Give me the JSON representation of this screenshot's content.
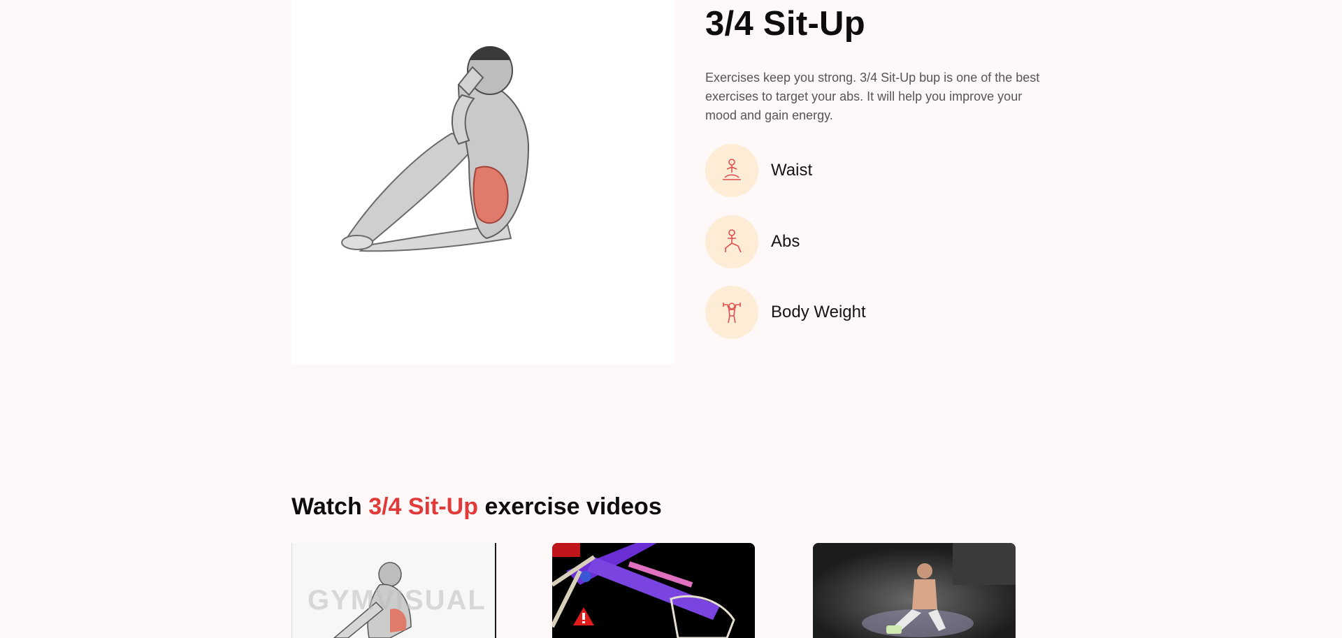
{
  "exercise": {
    "title": "3/4 Sit-Up",
    "description": "Exercises keep you strong. 3/4 Sit-Up bup is one of the best exercises to target your abs. It will help you improve your mood and gain energy.",
    "image_icon": "sit-up-anatomy-illustration",
    "targets": [
      {
        "label": "Waist",
        "icon": "meditation-pose-icon"
      },
      {
        "label": "Abs",
        "icon": "lunge-pose-icon"
      },
      {
        "label": "Body Weight",
        "icon": "dumbbell-lift-icon"
      }
    ]
  },
  "videos": {
    "heading_prefix": "Watch ",
    "heading_highlight": "3/4 Sit-Up",
    "heading_suffix": " exercise videos",
    "accent_color": "#e03a3a",
    "items": [
      {
        "thumbnail": "anatomy-sit-up-thumbnail",
        "watermark": "GYMVISUAL"
      },
      {
        "thumbnail": "skeleton-hip-flexor-thumbnail",
        "badge": "warning-icon"
      },
      {
        "thumbnail": "gym-sit-up-thumbnail"
      }
    ]
  },
  "colors": {
    "page_background": "#fff8f8",
    "icon_circle": "#fdecd6",
    "icon_stroke": "#e34d4d"
  }
}
